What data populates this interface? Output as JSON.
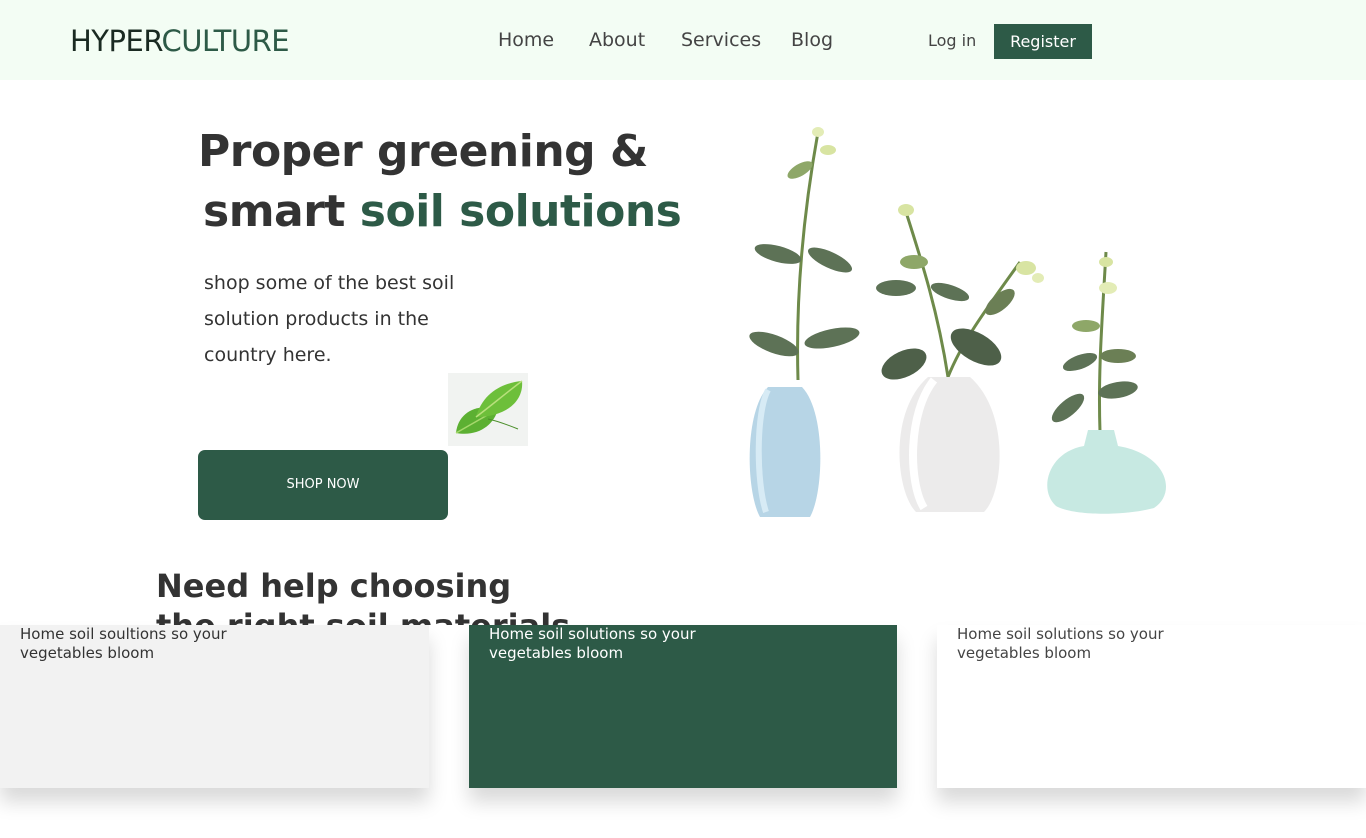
{
  "header": {
    "logo_part1": "HYPER",
    "logo_part2": "CULTURE",
    "nav": [
      {
        "label": "Home"
      },
      {
        "label": "About"
      },
      {
        "label": "Services"
      },
      {
        "label": "Blog"
      }
    ],
    "login_label": "Log in",
    "register_label": "Register"
  },
  "hero": {
    "title_line1": "Proper greening &",
    "title_line2_plain": "smart ",
    "title_line2_accent": "soil solutions",
    "subtitle": "shop some of the best soil solution products in the country here.",
    "cta_label": "SHOP NOW"
  },
  "section": {
    "title": "Need help choosing the right soil materials"
  },
  "cards": [
    {
      "text": "Home soil soultions so your vegetables bloom"
    },
    {
      "text": "Home soil solutions so your vegetables bloom"
    },
    {
      "text": "Home soil solutions so your vegetables bloom"
    }
  ],
  "colors": {
    "brand_green": "#2d5a47",
    "nav_background": "#f3fdf4",
    "text_dark": "#333333"
  },
  "icons": [
    "leaf-icon",
    "vase-plants-illustration"
  ]
}
